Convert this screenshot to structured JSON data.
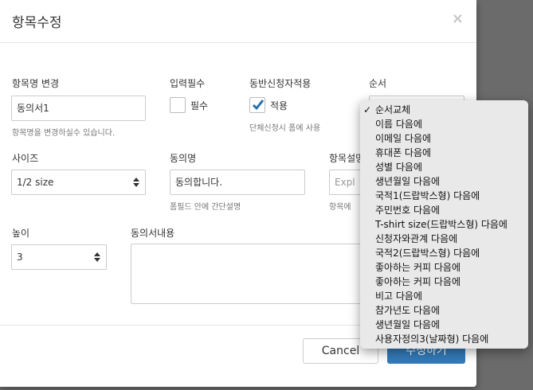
{
  "modal": {
    "title": "항목수정",
    "close_label": "×"
  },
  "fields": {
    "item_name": {
      "label": "항목명 변경",
      "value": "동의서1",
      "help": "항목명을 변경하실수 있습니다."
    },
    "required": {
      "label": "입력필수",
      "checkbox_label": "필수",
      "checked": false
    },
    "companion": {
      "label": "동반신청자적용",
      "checkbox_label": "적용",
      "checked": true,
      "help": "단체신청시 폼에 사용"
    },
    "order": {
      "label": "순서"
    },
    "size": {
      "label": "사이즈",
      "value": "1/2 size"
    },
    "agree_name": {
      "label": "동의명",
      "value": "동의합니다.",
      "help": "폼필드 안에 간단설명"
    },
    "item_desc": {
      "label": "항목설명",
      "placeholder": "Expl",
      "help": "항목에"
    },
    "height": {
      "label": "높이",
      "value": "3"
    },
    "agree_content": {
      "label": "동의서내용",
      "value": ""
    }
  },
  "footer": {
    "cancel_label": "Cancel",
    "save_label": "수정하기"
  },
  "order_dropdown": {
    "selected_index": 0,
    "options": [
      "순서교체",
      "이름 다음에",
      "이메일 다음에",
      "휴대폰 다음에",
      "성별 다음에",
      "생년월일 다음에",
      "국적1(드랍박스형) 다음에",
      "주민번호 다음에",
      "T-shirt size(드랍박스형) 다음에",
      "신청자와관계 다음에",
      "국적2(드랍박스형) 다음에",
      "좋아하는 커피 다음에",
      "좋아하는 커피 다음에",
      "비고 다음에",
      "참가년도 다음에",
      "생년월일 다음에",
      "사용자정의3(날짜형) 다음에"
    ]
  },
  "colors": {
    "primary": "#337ab7",
    "backdrop": "#6b6b6b"
  }
}
